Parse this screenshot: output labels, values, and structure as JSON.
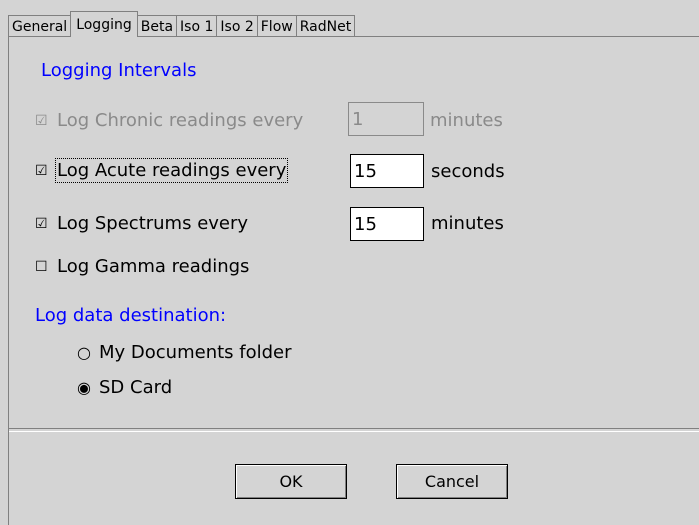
{
  "tabs": [
    {
      "label": "General",
      "active": false
    },
    {
      "label": "Logging",
      "active": true
    },
    {
      "label": "Beta",
      "active": false
    },
    {
      "label": "Iso 1",
      "active": false
    },
    {
      "label": "Iso 2",
      "active": false
    },
    {
      "label": "Flow",
      "active": false
    },
    {
      "label": "RadNet",
      "active": false
    }
  ],
  "logging_intervals": {
    "title": "Logging Intervals",
    "chronic": {
      "checked": true,
      "enabled": false,
      "label": "Log Chronic readings every",
      "value": "1",
      "unit": "minutes"
    },
    "acute": {
      "checked": true,
      "enabled": true,
      "label": "Log Acute readings every",
      "value": "15",
      "unit": "seconds"
    },
    "spectrums": {
      "checked": true,
      "enabled": true,
      "label": "Log Spectrums every",
      "value": "15",
      "unit": "minutes"
    },
    "gamma": {
      "checked": false,
      "enabled": true,
      "label": "Log Gamma readings"
    }
  },
  "destination": {
    "title": "Log data destination:",
    "options": [
      {
        "label": "My Documents folder",
        "selected": false
      },
      {
        "label": "SD Card",
        "selected": true
      }
    ]
  },
  "buttons": {
    "ok": "OK",
    "cancel": "Cancel"
  },
  "glyphs": {
    "checked": "☑",
    "unchecked": "☐",
    "radio_on": "◉",
    "radio_off": "○"
  }
}
